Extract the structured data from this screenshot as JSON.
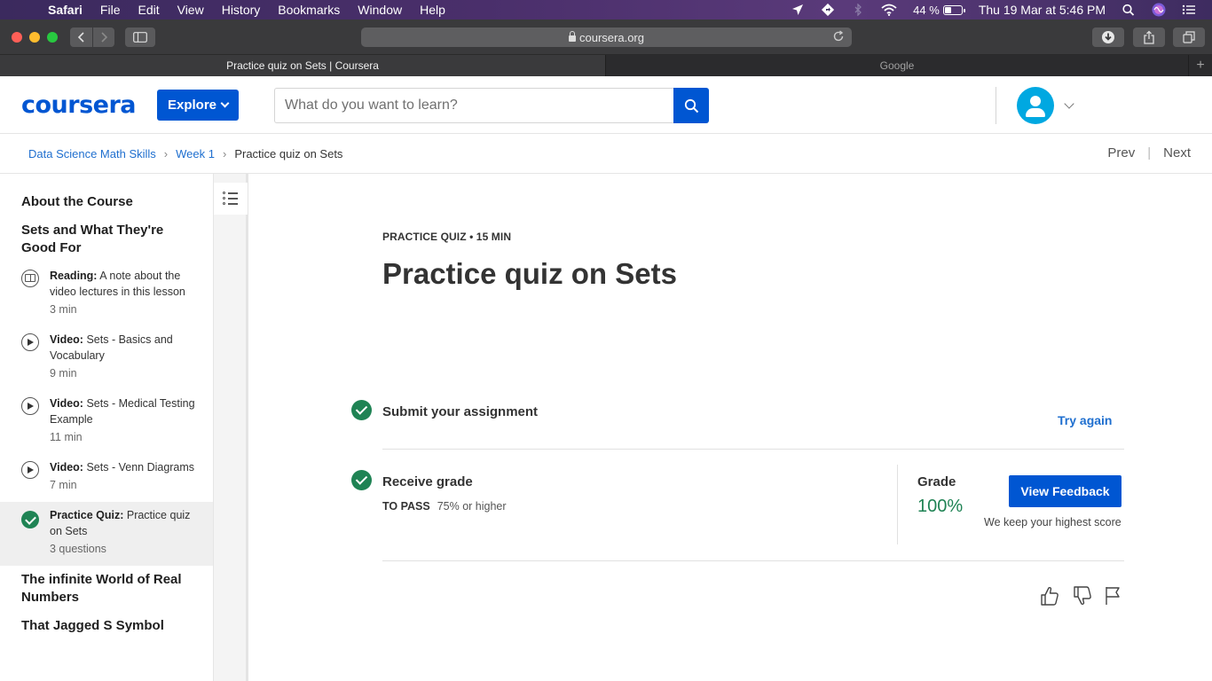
{
  "menubar": {
    "apple": "",
    "app_name": "Safari",
    "items": [
      "File",
      "Edit",
      "View",
      "History",
      "Bookmarks",
      "Window",
      "Help"
    ],
    "battery_percent": "44 %",
    "battery_level": 0.44,
    "datetime": "Thu 19 Mar at  5:46 PM"
  },
  "browser": {
    "url": "coursera.org",
    "tabs": [
      {
        "title": "Practice quiz on Sets | Coursera",
        "active": true
      },
      {
        "title": "Google",
        "active": false
      }
    ],
    "new_tab": "+"
  },
  "header": {
    "logo": "coursera",
    "explore": "Explore",
    "search_placeholder": "What do you want to learn?"
  },
  "breadcrumb": {
    "items": [
      "Data Science Math Skills",
      "Week 1",
      "Practice quiz on Sets"
    ],
    "sep": "›",
    "prev": "Prev",
    "next": "Next",
    "divider": "|"
  },
  "sidebar": {
    "sections": [
      "About the Course",
      "Sets and What They're Good For",
      "The infinite World of Real Numbers",
      "That Jagged S Symbol"
    ],
    "lessons": [
      {
        "kind": "Reading:",
        "title": "A note about the video lectures in this lesson",
        "meta": "3 min"
      },
      {
        "kind": "Video:",
        "title": "Sets - Basics and Vocabulary",
        "meta": "9 min"
      },
      {
        "kind": "Video:",
        "title": "Sets - Medical Testing Example",
        "meta": "11 min"
      },
      {
        "kind": "Video:",
        "title": "Sets - Venn Diagrams",
        "meta": "7 min"
      },
      {
        "kind": "Practice Quiz:",
        "title": "Practice quiz on Sets",
        "meta": "3 questions"
      }
    ]
  },
  "main": {
    "eyebrow": "PRACTICE QUIZ • 15 MIN",
    "title": "Practice quiz on Sets",
    "submit_label": "Submit your assignment",
    "try_again": "Try again",
    "receive_label": "Receive grade",
    "to_pass_key": "TO PASS",
    "to_pass_value": "75% or higher",
    "grade_label": "Grade",
    "grade_value": "100%",
    "view_feedback": "View Feedback",
    "highest_note": "We keep your highest score"
  },
  "colors": {
    "brand_blue": "#0056d2",
    "success_green": "#1f8354",
    "link_blue": "#1f6fcf"
  }
}
